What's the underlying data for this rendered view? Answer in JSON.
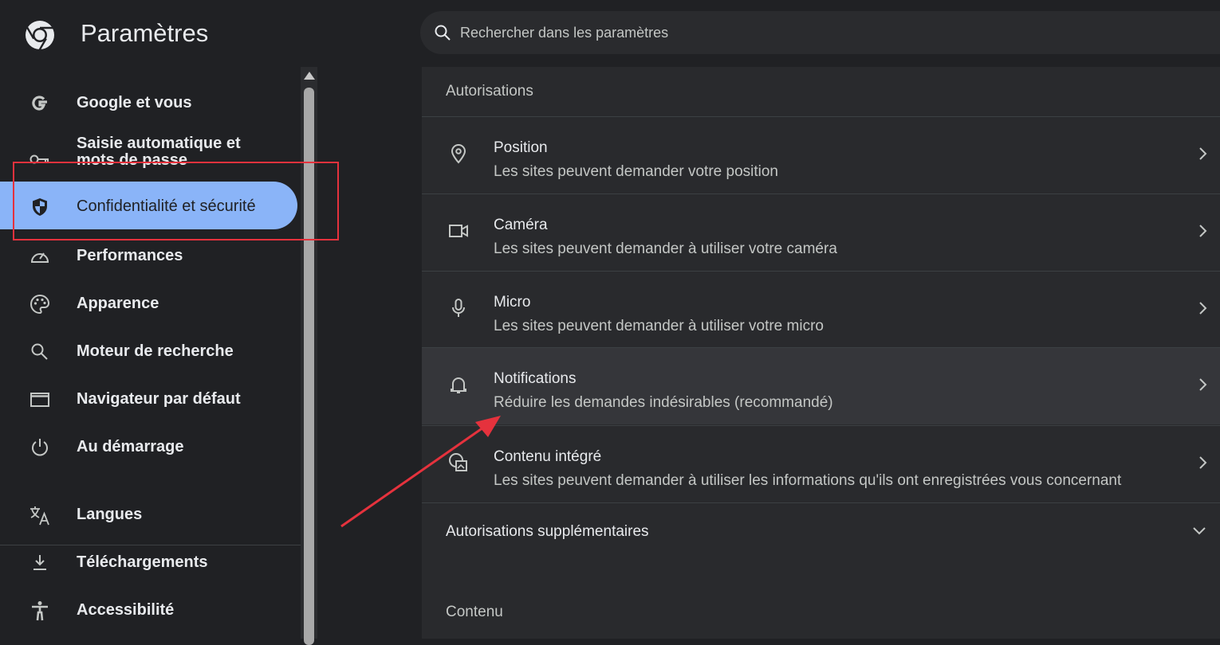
{
  "header": {
    "title": "Paramètres",
    "search_placeholder": "Rechercher dans les paramètres"
  },
  "sidebar": {
    "items": [
      {
        "label": "Google et vous",
        "icon": "google-icon"
      },
      {
        "label": "Saisie automatique et mots de passe",
        "icon": "key-icon"
      },
      {
        "label": "Confidentialité et sécurité",
        "icon": "shield-icon",
        "active": true
      },
      {
        "label": "Performances",
        "icon": "speedometer-icon"
      },
      {
        "label": "Apparence",
        "icon": "palette-icon"
      },
      {
        "label": "Moteur de recherche",
        "icon": "search-icon"
      },
      {
        "label": "Navigateur par défaut",
        "icon": "browser-window-icon"
      },
      {
        "label": "Au démarrage",
        "icon": "power-icon"
      },
      {
        "label": "Langues",
        "icon": "translate-icon"
      },
      {
        "label": "Téléchargements",
        "icon": "download-icon"
      },
      {
        "label": "Accessibilité",
        "icon": "accessibility-icon"
      }
    ]
  },
  "main": {
    "section_title": "Autorisations",
    "permissions": [
      {
        "title": "Position",
        "subtitle": "Les sites peuvent demander votre position",
        "icon": "location-pin-icon"
      },
      {
        "title": "Caméra",
        "subtitle": "Les sites peuvent demander à utiliser votre caméra",
        "icon": "camera-icon"
      },
      {
        "title": "Micro",
        "subtitle": "Les sites peuvent demander à utiliser votre micro",
        "icon": "microphone-icon"
      },
      {
        "title": "Notifications",
        "subtitle": "Réduire les demandes indésirables (recommandé)",
        "icon": "bell-icon"
      },
      {
        "title": "Contenu intégré",
        "subtitle": "Les sites peuvent demander à utiliser les informations qu'ils ont enregistrées vous concernant",
        "icon": "embedded-content-icon"
      }
    ],
    "additional_permissions": "Autorisations supplémentaires",
    "content_section_title": "Contenu"
  },
  "colors": {
    "active_nav": "#8ab4f8",
    "annotation": "#e5323d",
    "background": "#202124",
    "content_background": "#292a2d"
  }
}
